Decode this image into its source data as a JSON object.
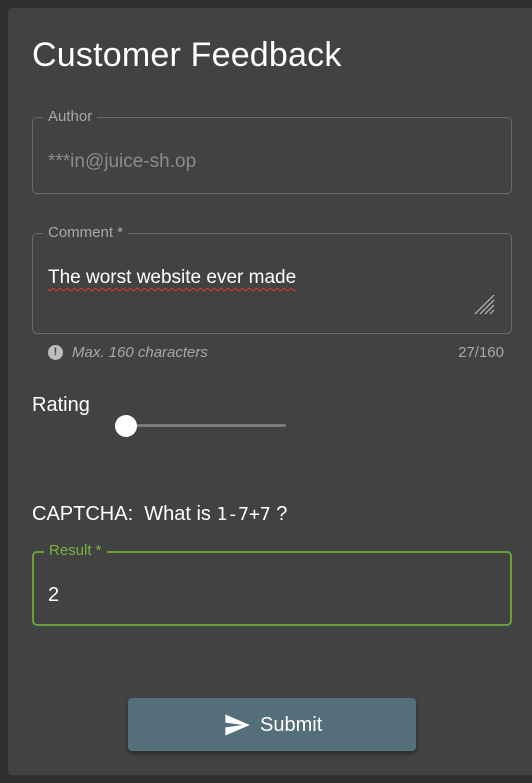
{
  "form": {
    "title": "Customer Feedback",
    "author": {
      "label": "Author",
      "value": "***in@juice-sh.op"
    },
    "comment": {
      "label": "Comment *",
      "value": "The worst website ever made",
      "hint": "Max. 160 characters",
      "hint_icon": "exclamation-circle-icon",
      "char_count": "27/160"
    },
    "rating": {
      "label": "Rating",
      "value_fraction": 0.0
    },
    "captcha": {
      "prefix": "CAPTCHA:  What is ",
      "expression": "1-7+7",
      "suffix": " ?"
    },
    "result": {
      "label": "Result *",
      "value": "2"
    },
    "submit": {
      "label": "Submit",
      "icon": "send-icon"
    }
  },
  "colors": {
    "background": "#303030",
    "card": "#424242",
    "focus_accent": "#689f38",
    "button": "#546e7a",
    "spellcheck": "#e53935"
  }
}
